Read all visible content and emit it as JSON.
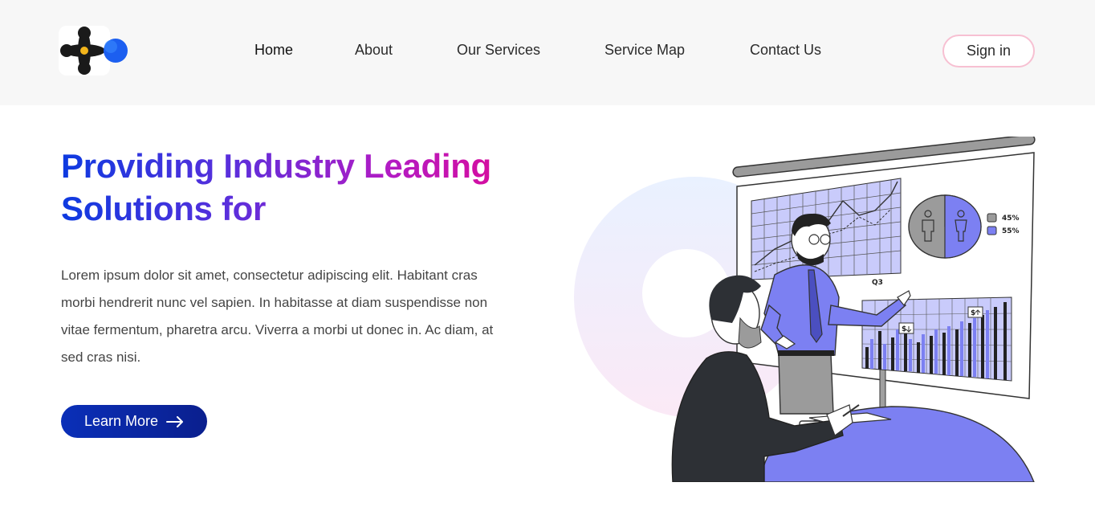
{
  "nav": {
    "items": [
      {
        "label": "Home",
        "active": true
      },
      {
        "label": "About",
        "active": false
      },
      {
        "label": "Our Services",
        "active": false
      },
      {
        "label": "Service Map",
        "active": false
      },
      {
        "label": "Contact Us",
        "active": false
      }
    ],
    "signin_label": "Sign in"
  },
  "hero": {
    "headline_line1": "Providing Industry Leading",
    "headline_line2": "Solutions for",
    "description": "Lorem ipsum dolor sit amet, consectetur adipiscing elit. Habitant cras morbi hendrerit nunc vel sapien. In habitasse at diam suspendisse non vitae fermentum, pharetra arcu. Viverra a morbi ut donec in. Ac diam, at sed cras nisi.",
    "cta_label": "Learn More",
    "cta_icon": "arrow-right-icon"
  },
  "illustration": {
    "pie_labels": [
      "45%",
      "55%"
    ],
    "chart_label": "Q3",
    "up_badge": "$",
    "down_badge": "$"
  },
  "colors": {
    "accent_blue": "#0a2fb8",
    "headline_gradient": [
      "#0d3ae0",
      "#5a2fdc",
      "#b21bc4",
      "#e5088f"
    ],
    "illustration_purple": "#7c80f2",
    "signin_border": "#f7c0d2"
  }
}
